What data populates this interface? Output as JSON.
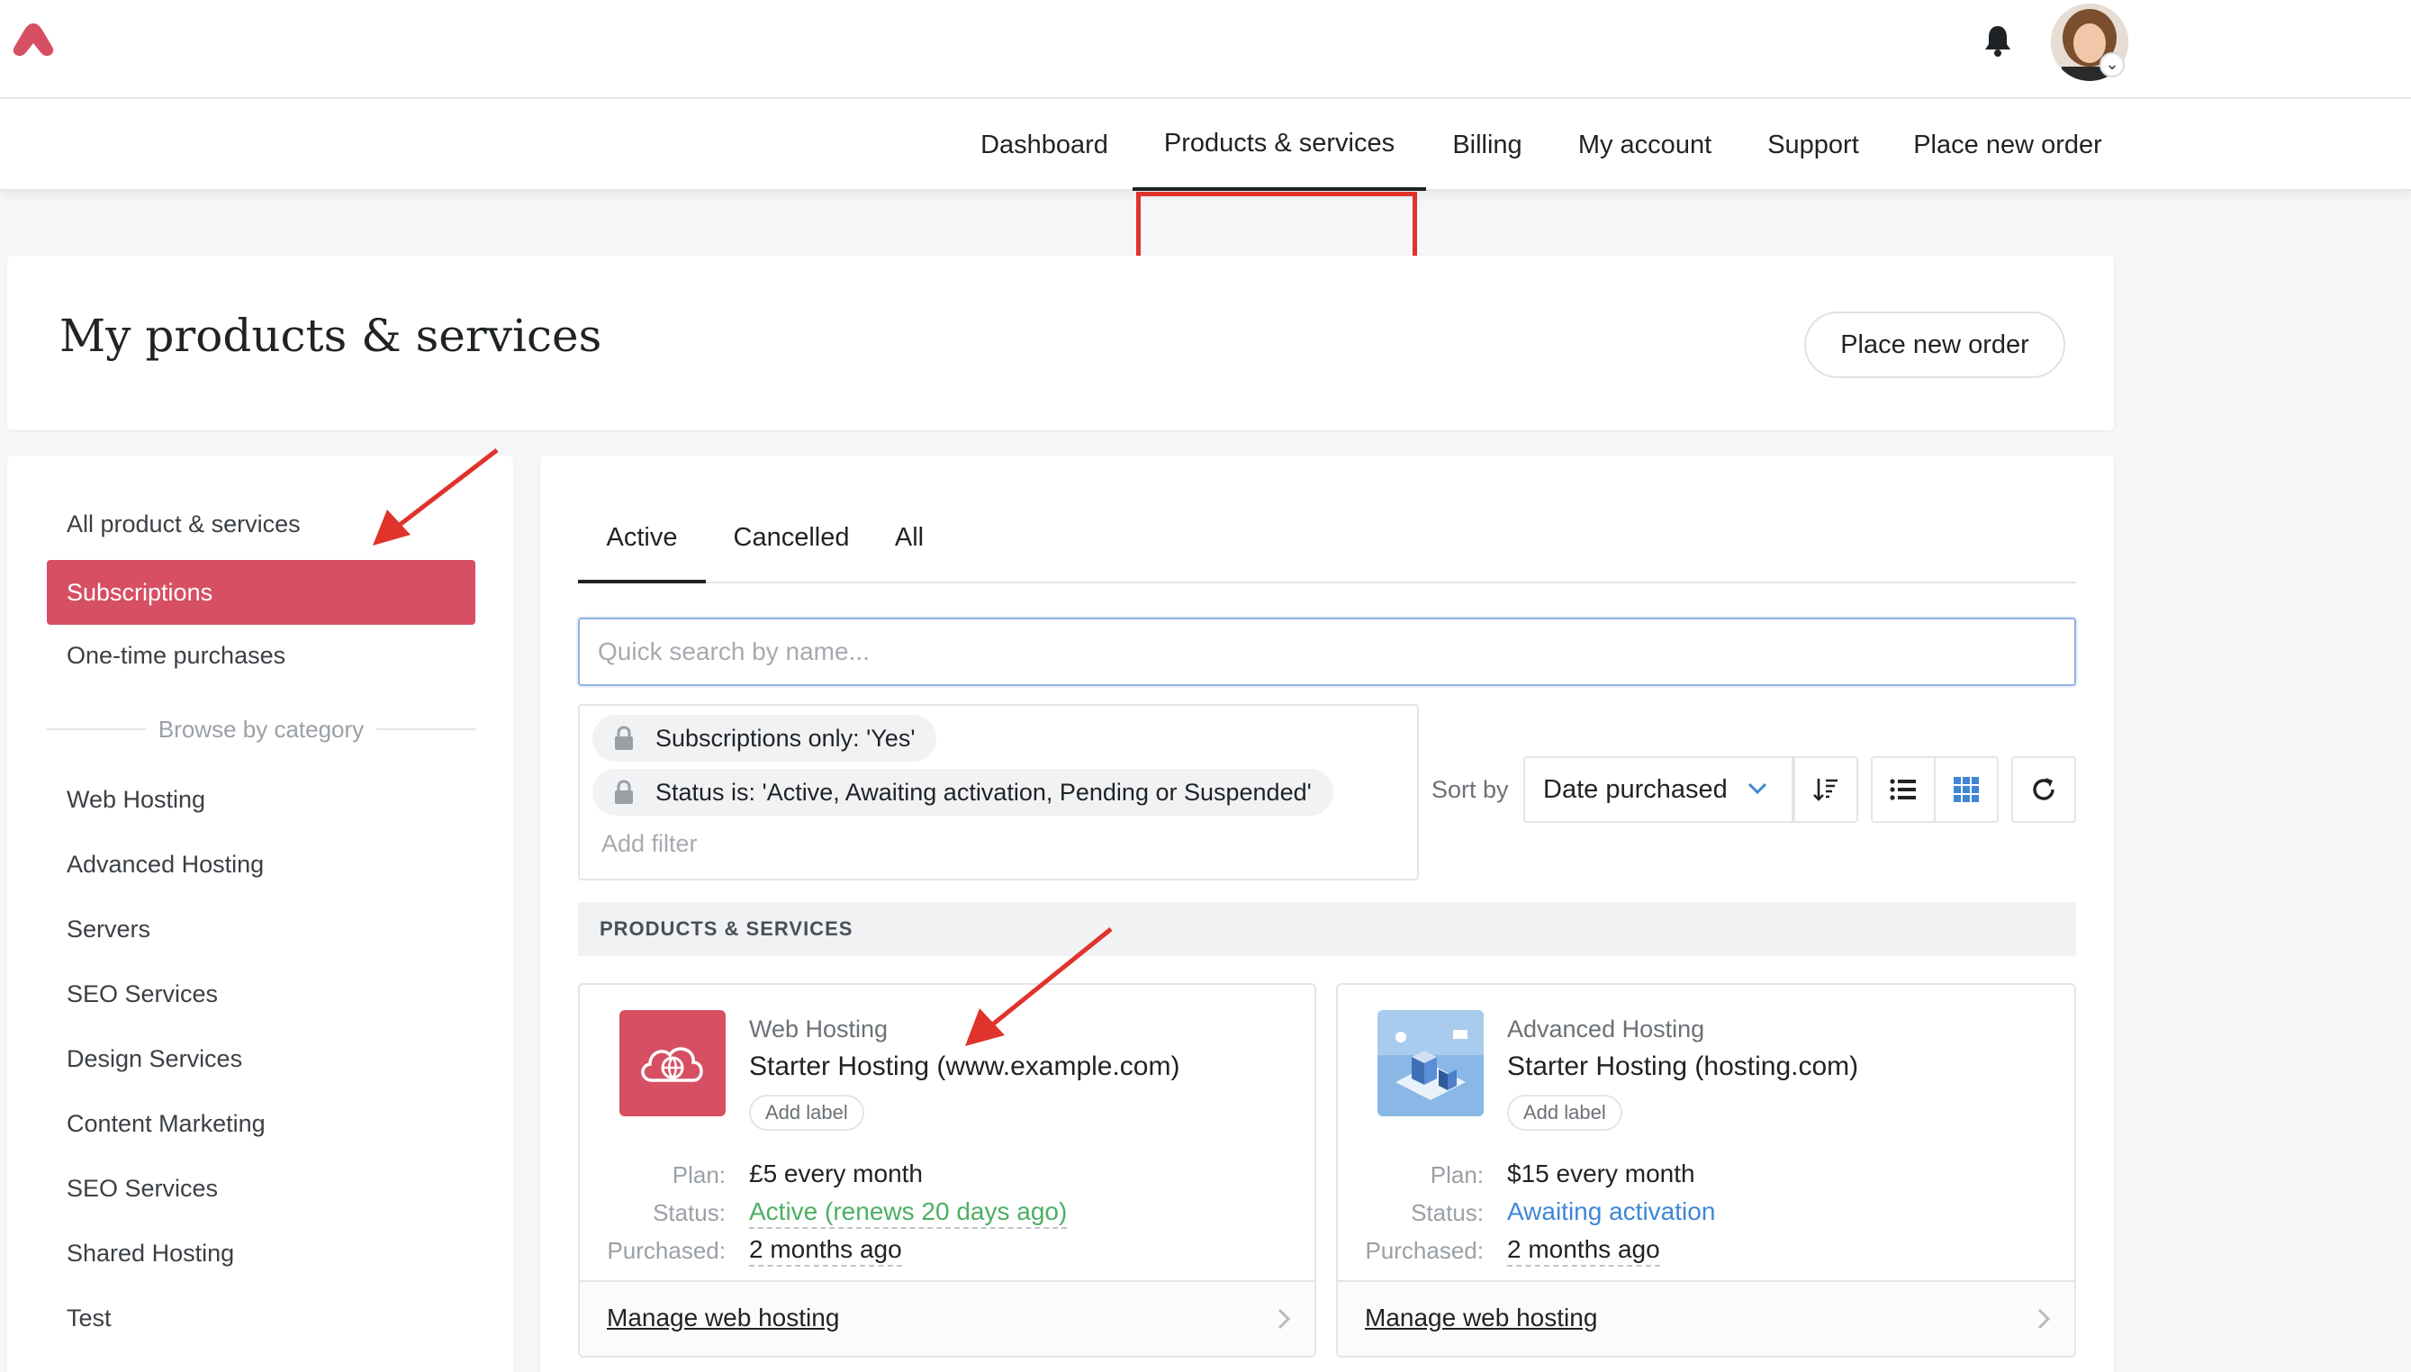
{
  "nav": {
    "items": [
      "Dashboard",
      "Products & services",
      "Billing",
      "My account",
      "Support",
      "Place new order"
    ],
    "active": "Products & services"
  },
  "header": {
    "title": "My products & services",
    "place_order_label": "Place new order"
  },
  "sidebar": {
    "items": [
      "All product & services",
      "Subscriptions",
      "One-time purchases"
    ],
    "active": "Subscriptions",
    "browse_label": "Browse by category",
    "categories": [
      "Web Hosting",
      "Advanced Hosting",
      "Servers",
      "SEO Services",
      "Design Services",
      "Content Marketing",
      "SEO Services",
      "Shared Hosting",
      "Test"
    ]
  },
  "main": {
    "tabs": [
      "Active",
      "Cancelled",
      "All"
    ],
    "active_tab": "Active",
    "search": {
      "placeholder": "Quick search by name..."
    },
    "filters": [
      "Subscriptions only: 'Yes'",
      "Status is: 'Active, Awaiting activation, Pending or Suspended'"
    ],
    "add_filter": "Add filter",
    "sort_label": "Sort by",
    "sort_value": "Date purchased",
    "section_title": "PRODUCTS & SERVICES",
    "products": [
      {
        "category": "Web Hosting",
        "name": "Starter Hosting (www.example.com)",
        "add_label": "Add label",
        "plan_key": "Plan:",
        "plan": "£5 every month",
        "status_key": "Status:",
        "status": "Active (renews 20 days ago)",
        "status_color": "#4caf63",
        "purchased_key": "Purchased:",
        "purchased": "2 months ago",
        "manage": "Manage web hosting",
        "icon": "cloud-globe-icon"
      },
      {
        "category": "Advanced Hosting",
        "name": "Starter Hosting (hosting.com)",
        "add_label": "Add label",
        "plan_key": "Plan:",
        "plan": "$15 every month",
        "status_key": "Status:",
        "status": "Awaiting activation",
        "status_color": "#3f86d6",
        "purchased_key": "Purchased:",
        "purchased": "2 months ago",
        "manage": "Manage web hosting",
        "icon": "isometric-server-image"
      }
    ]
  },
  "colors": {
    "brand": "#d64f63",
    "annotation": "#e0332c"
  }
}
